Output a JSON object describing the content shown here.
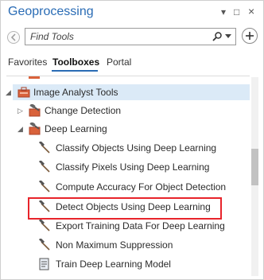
{
  "window": {
    "title": "Geoprocessing",
    "controls": [
      "▾",
      "□",
      "×"
    ]
  },
  "search": {
    "placeholder": "Find Tools"
  },
  "tabs": [
    {
      "label": "Favorites",
      "active": false
    },
    {
      "label": "Toolboxes",
      "active": true
    },
    {
      "label": "Portal",
      "active": false
    }
  ],
  "tree": {
    "toolbox": "Image Analyst Tools",
    "toolsets": [
      {
        "label": "Change Detection",
        "expanded": false
      },
      {
        "label": "Deep Learning",
        "expanded": true
      }
    ],
    "tools": [
      "Classify Objects Using Deep Learning",
      "Classify Pixels Using Deep Learning",
      "Compute Accuracy For Object Detection",
      "Detect Objects Using Deep Learning",
      "Export Training Data For Deep Learning",
      "Non Maximum Suppression",
      "Train Deep Learning Model"
    ],
    "highlighted_tool_index": 3
  },
  "colors": {
    "title": "#2a6cb5",
    "highlight_border": "#e8242b",
    "toolbox_icon": "#d9623b",
    "hammer": "#4a4a4a"
  },
  "icons": {
    "back": "back-arrow-icon",
    "search": "search-icon",
    "add": "add-icon",
    "toolbox": "toolbox-icon",
    "tool": "hammer-icon",
    "script": "script-tool-icon"
  }
}
